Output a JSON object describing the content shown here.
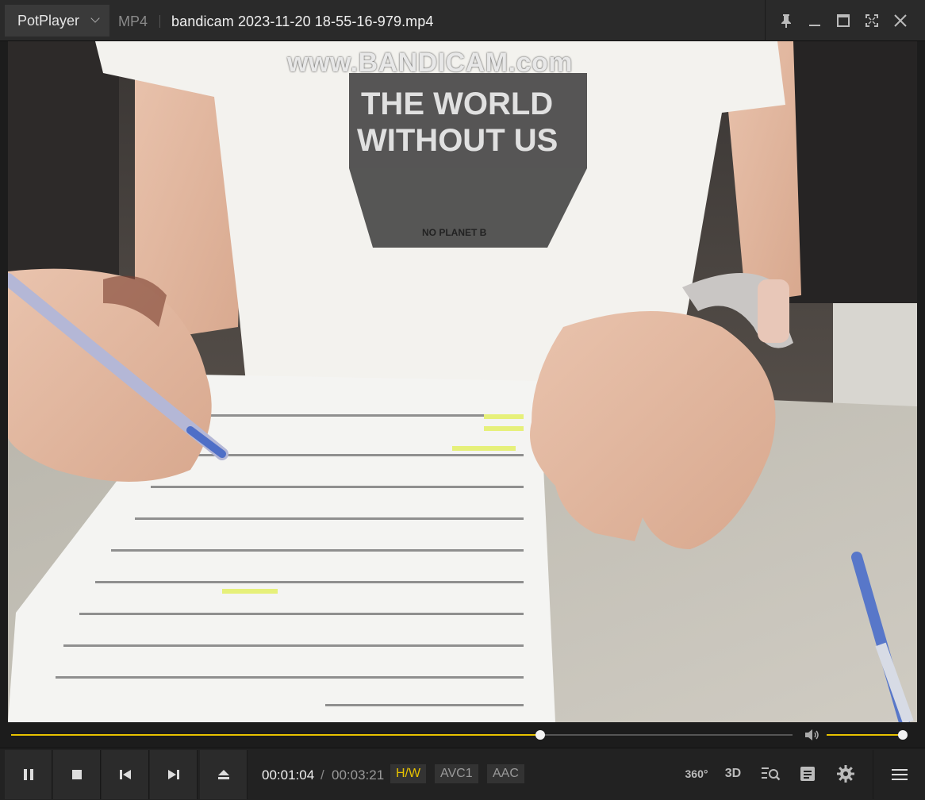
{
  "app": {
    "name": "PotPlayer",
    "format": "MP4",
    "file_title": "bandicam 2023-11-20 18-55-16-979.mp4"
  },
  "video": {
    "watermark": "www.BANDICAM.com"
  },
  "playback": {
    "current_time": "00:01:04",
    "separator": "/",
    "total_time": "00:03:21",
    "progress": 0.677,
    "volume": 1.0
  },
  "badges": {
    "hw": "H/W",
    "video_codec": "AVC1",
    "audio_codec": "AAC"
  },
  "right_controls": {
    "vr": "360°",
    "threed": "3D"
  },
  "colors": {
    "accent": "#e7c200",
    "bg": "#1c1c1c",
    "panel": "#2b2b2b"
  },
  "icons": {
    "window": [
      "pin-icon",
      "minimize-icon",
      "maximize-icon",
      "fullscreen-icon",
      "close-icon"
    ],
    "transport": [
      "pause-icon",
      "stop-icon",
      "previous-icon",
      "next-icon",
      "eject-icon"
    ],
    "right": [
      "vr-360-icon",
      "3d-icon",
      "search-list-icon",
      "playlist-icon",
      "settings-gear-icon",
      "menu-icon"
    ]
  }
}
